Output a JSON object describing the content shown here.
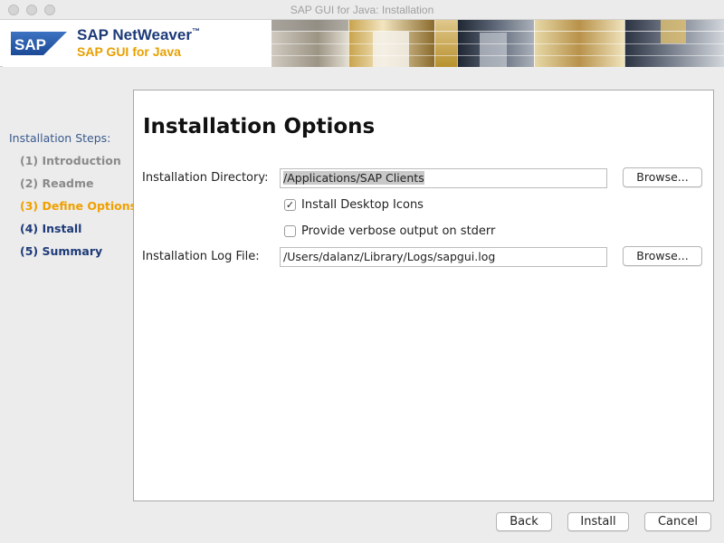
{
  "window": {
    "title": "SAP GUI for Java: Installation"
  },
  "banner": {
    "logo_text": "SAP",
    "product_line": "SAP NetWeaver",
    "trademark": "™",
    "product_name": "SAP GUI for Java",
    "colors": {
      "navy": "#1d3a78",
      "gold": "#e8a000"
    }
  },
  "sidebar": {
    "title": "Installation Steps:",
    "steps": [
      {
        "label": "(1) Introduction",
        "state": "done"
      },
      {
        "label": "(2) Readme",
        "state": "done"
      },
      {
        "label": "(3) Define Options",
        "state": "current"
      },
      {
        "label": "(4) Install",
        "state": "todo"
      },
      {
        "label": "(5) Summary",
        "state": "todo"
      }
    ]
  },
  "main": {
    "heading": "Installation Options",
    "install_dir": {
      "label": "Installation Directory:",
      "value": "/Applications/SAP Clients",
      "browse_label": "Browse..."
    },
    "options": [
      {
        "label": "Install Desktop Icons",
        "checked": true
      },
      {
        "label": "Provide verbose output on stderr",
        "checked": false
      }
    ],
    "log_file": {
      "label": "Installation Log File:",
      "value": "/Users/dalanz/Library/Logs/sapgui.log",
      "browse_label": "Browse..."
    }
  },
  "footer": {
    "back_label": "Back",
    "install_label": "Install",
    "cancel_label": "Cancel"
  }
}
